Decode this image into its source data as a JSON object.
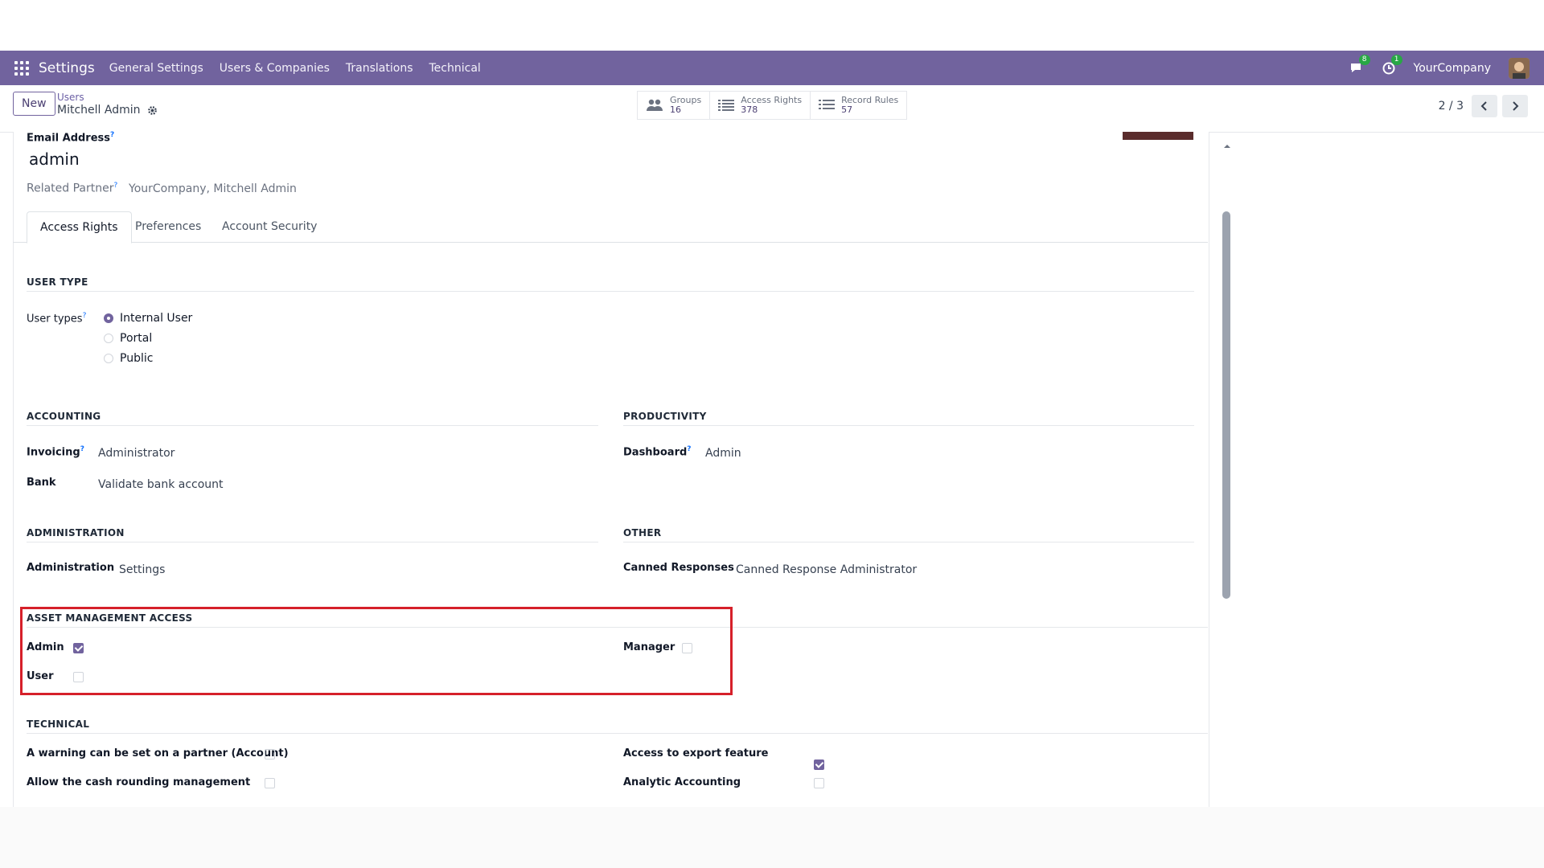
{
  "navbar": {
    "brand": "Settings",
    "menu": [
      "General Settings",
      "Users & Companies",
      "Translations",
      "Technical"
    ],
    "messages_badge": "8",
    "activity_badge": "1",
    "company": "YourCompany"
  },
  "control": {
    "new_label": "New",
    "breadcrumb_parent": "Users",
    "breadcrumb_current": "Mitchell Admin",
    "smart_buttons": [
      {
        "label": "Groups",
        "count": "16"
      },
      {
        "label": "Access Rights",
        "count": "378"
      },
      {
        "label": "Record Rules",
        "count": "57"
      }
    ],
    "pager": "2 / 3"
  },
  "form": {
    "email_label": "Email Address",
    "email_value": "admin",
    "partner_label": "Related Partner",
    "partner_value": "YourCompany, Mitchell Admin",
    "tabs": [
      "Access Rights",
      "Preferences",
      "Account Security"
    ],
    "user_type": {
      "title": "USER TYPE",
      "label": "User types",
      "options": [
        "Internal User",
        "Portal",
        "Public"
      ],
      "selected": "Internal User"
    },
    "accounting": {
      "title": "ACCOUNTING",
      "invoicing_label": "Invoicing",
      "invoicing_value": "Administrator",
      "bank_label": "Bank",
      "bank_value": "Validate bank account"
    },
    "productivity": {
      "title": "PRODUCTIVITY",
      "dashboard_label": "Dashboard",
      "dashboard_value": "Admin"
    },
    "administration": {
      "title": "ADMINISTRATION",
      "label": "Administration",
      "value": "Settings"
    },
    "other": {
      "title": "OTHER",
      "canned_label": "Canned Responses",
      "canned_value": "Canned Response Administrator"
    },
    "asset": {
      "title": "ASSET MANAGEMENT ACCESS",
      "admin_label": "Admin",
      "admin_checked": true,
      "user_label": "User",
      "user_checked": false,
      "manager_label": "Manager",
      "manager_checked": false
    },
    "technical": {
      "title": "TECHNICAL",
      "left": [
        {
          "label": "A warning can be set on a partner (Account)",
          "checked": false
        },
        {
          "label": "Allow the cash rounding management",
          "checked": false
        }
      ],
      "right": [
        {
          "label": "Access to export feature",
          "checked": true
        },
        {
          "label": "Analytic Accounting",
          "checked": false
        }
      ]
    }
  },
  "colors": {
    "brand": "#71639e",
    "highlight": "#d6202a"
  }
}
